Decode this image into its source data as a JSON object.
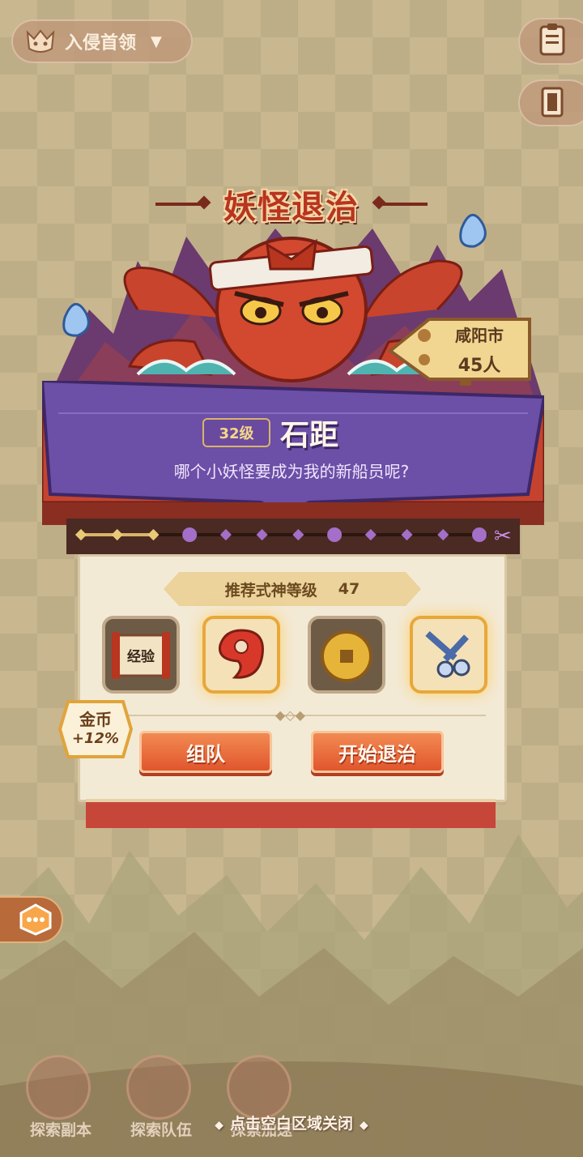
{
  "header": {
    "mode_label": "入侵首领"
  },
  "event": {
    "title": "妖怪退治",
    "boss_level": "32级",
    "boss_name": "石距",
    "boss_quote": "哪个小妖怪要成为我的新船员呢?",
    "location": {
      "city": "咸阳市",
      "count": "45人"
    }
  },
  "progress": {
    "total_nodes": 12,
    "reached_nodes": 3
  },
  "panel": {
    "recommend_label": "推荐式神等级",
    "recommend_value": "47",
    "rewards": [
      {
        "name": "经验",
        "icon": "exp-scroll-icon",
        "frame": "grey"
      },
      {
        "name": "",
        "icon": "red-magatama-icon",
        "frame": "gold"
      },
      {
        "name": "",
        "icon": "gold-coin-icon",
        "frame": "grey"
      },
      {
        "name": "",
        "icon": "scissors-icon",
        "frame": "gold"
      }
    ],
    "coin_bonus_label": "金币",
    "coin_bonus_value": "+12%",
    "team_button": "组队",
    "start_button": "开始退治"
  },
  "bottom_nav": [
    {
      "label": "探索副本",
      "icon": "magnifier-icon"
    },
    {
      "label": "探索队伍",
      "icon": "team-icon"
    },
    {
      "label": "探索加速",
      "icon": "speedup-icon"
    }
  ],
  "close_hint": "点击空白区域关闭",
  "colors": {
    "accent_red": "#b8351f",
    "banner_purple": "#6a4a9e",
    "button_orange": "#e1562d",
    "panel_cream": "#f3ead6"
  }
}
